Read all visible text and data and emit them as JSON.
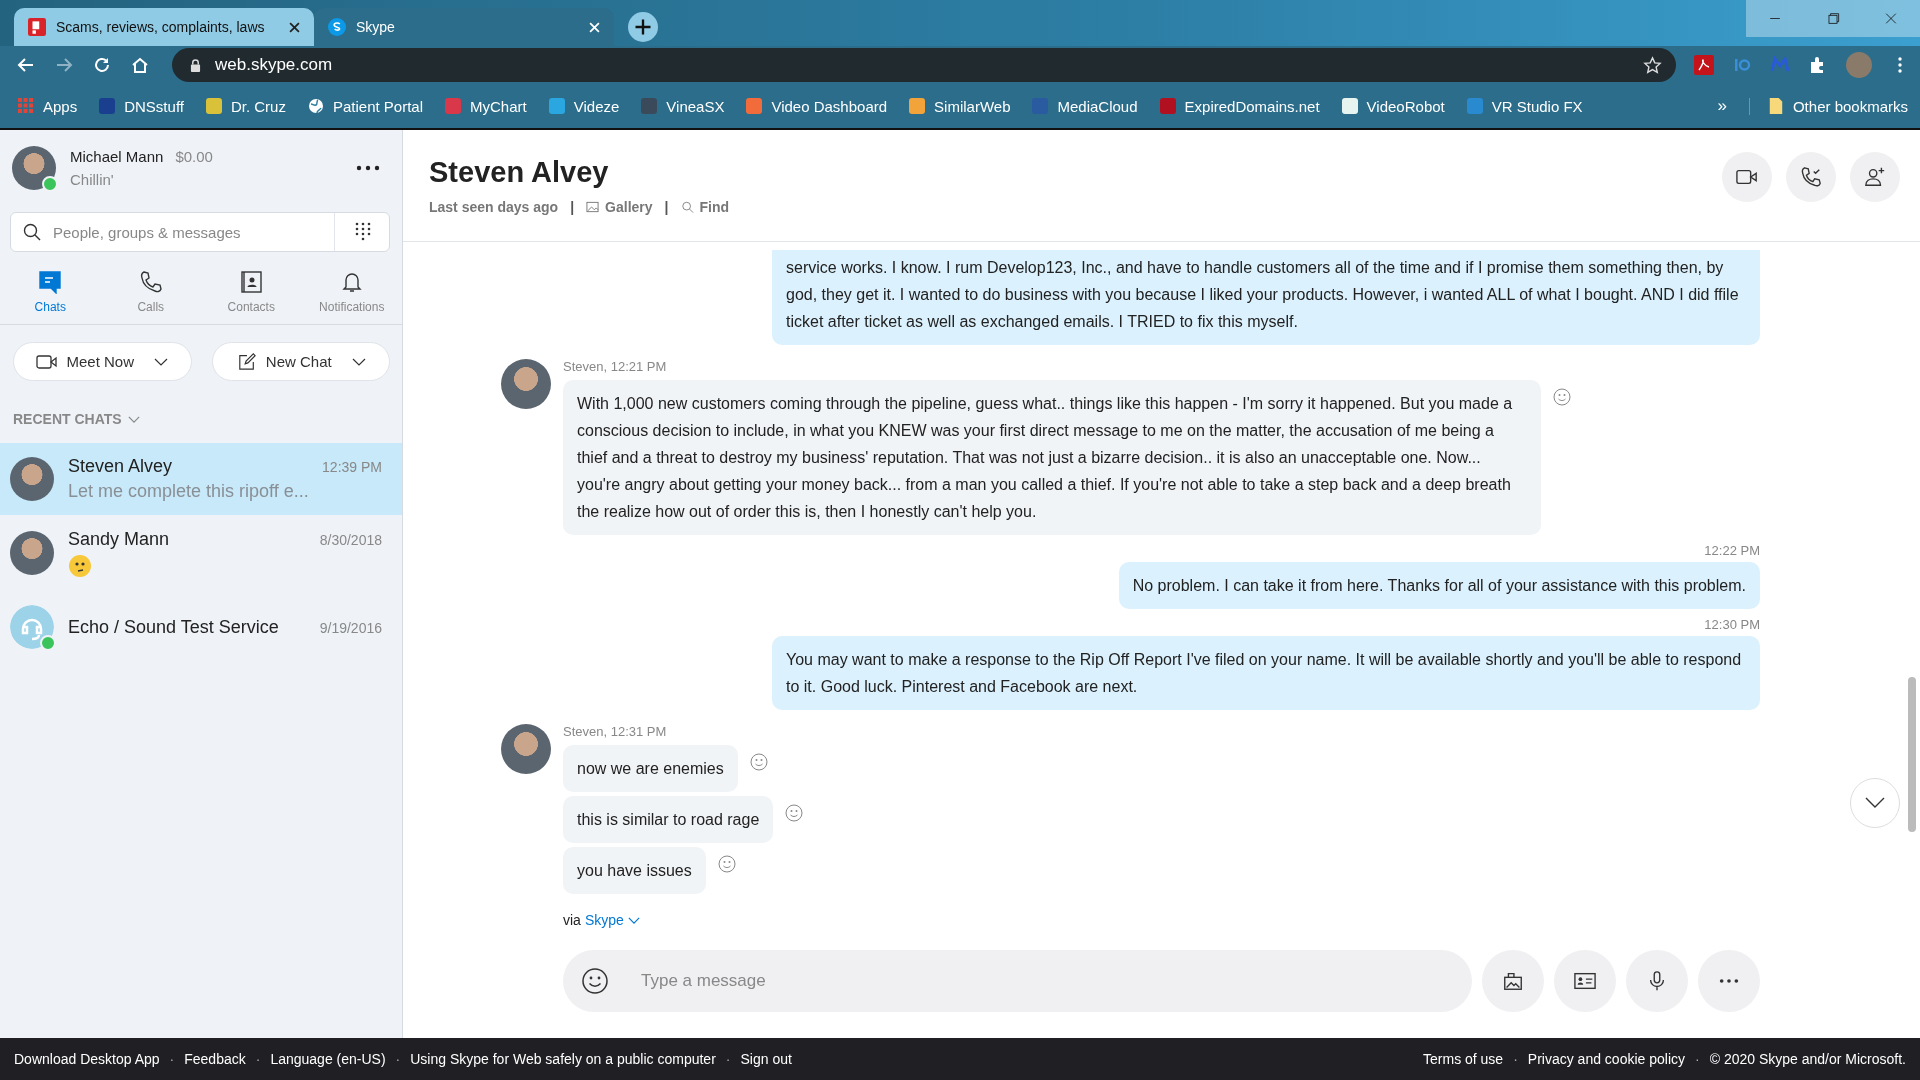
{
  "browser": {
    "tabs": [
      {
        "title": "Scams, reviews, complaints, laws",
        "selected": false,
        "kind": "report"
      },
      {
        "title": "Skype",
        "selected": true,
        "kind": "skype"
      }
    ],
    "address": "web.skype.com",
    "bookmarks": [
      {
        "label": "Apps",
        "kind": "apps",
        "color": "#e0453a"
      },
      {
        "label": "DNSstuff",
        "kind": "site",
        "color": "#1a3f8f"
      },
      {
        "label": "Dr. Cruz",
        "kind": "site",
        "color": "#d9c23a"
      },
      {
        "label": "Patient Portal",
        "kind": "globe",
        "color": "#ffffff"
      },
      {
        "label": "MyChart",
        "kind": "site",
        "color": "#d8384a"
      },
      {
        "label": "Videze",
        "kind": "site",
        "color": "#2aa6e0"
      },
      {
        "label": "VineaSX",
        "kind": "site",
        "color": "#3a4a5a"
      },
      {
        "label": "Video Dashboard",
        "kind": "site",
        "color": "#f26b3a"
      },
      {
        "label": "SimilarWeb",
        "kind": "site",
        "color": "#f2a33a"
      },
      {
        "label": "MediaCloud",
        "kind": "site",
        "color": "#2a5aa0"
      },
      {
        "label": "ExpiredDomains.net",
        "kind": "site",
        "color": "#b01020"
      },
      {
        "label": "VideoRobot",
        "kind": "site",
        "color": "#e8f4f0"
      },
      {
        "label": "VR Studio FX",
        "kind": "site",
        "color": "#2a8ad0"
      }
    ],
    "overflow": "»",
    "other_bookmarks": "Other bookmarks"
  },
  "profile": {
    "name": "Michael Mann",
    "credit": "$0.00",
    "mood": "Chillin'",
    "online": true
  },
  "search": {
    "placeholder": "People, groups & messages"
  },
  "nav": [
    {
      "label": "Chats",
      "kind": "chats",
      "selected": true
    },
    {
      "label": "Calls",
      "kind": "calls",
      "selected": false
    },
    {
      "label": "Contacts",
      "kind": "contacts",
      "selected": false
    },
    {
      "label": "Notifications",
      "kind": "notifications",
      "selected": false
    }
  ],
  "actions": {
    "meet_now": "Meet Now",
    "new_chat": "New Chat"
  },
  "recent_heading": "RECENT CHATS",
  "chats": [
    {
      "kind": "person",
      "name": "Steven Alvey",
      "time": "12:39 PM",
      "preview": "Let me complete this ripoff e...",
      "online": false,
      "selected": true
    },
    {
      "kind": "person",
      "name": "Sandy Mann",
      "time": "8/30/2018",
      "emoji": true,
      "online": false,
      "selected": false
    },
    {
      "kind": "bot",
      "name": "Echo / Sound Test Service",
      "time": "9/19/2016",
      "online": true,
      "selected": false
    }
  ],
  "conversation": {
    "name": "Steven Alvey",
    "last_seen": "Last seen days ago",
    "separator": "|",
    "gallery": "Gallery",
    "find": "Find"
  },
  "messages": [
    {
      "kind": "sent",
      "text": "service works. I know. I rum Develop123, Inc., and have to handle customers all of the time and if I promise them something then, by god, they get it. I wanted to do business with you because I liked your products. However, i wanted ALL of what I bought. AND I did ffile ticket after ticket as well as exchanged emails. I TRIED to fix this myself."
    },
    {
      "kind": "received",
      "header": "Steven, 12:21 PM",
      "bubbles": [
        "With 1,000 new customers coming through the pipeline, guess what.. things like this happen - I'm sorry it happened.  But you made a conscious decision to include, in what you KNEW was your first direct message to me on the matter, the accusation of me being a thief and a threat to destroy my business' reputation.  That was not just a bizarre decision.. it is also an unacceptable one.   Now... you're angry about getting your money back... from a man you called a thief.  If you're not able to take a step back and a deep breath the realize how out of order this is, then I honestly can't help you."
      ]
    },
    {
      "kind": "sent",
      "time": "12:22 PM",
      "text": "No problem. I can take it from here. Thanks for all of your assistance with this problem."
    },
    {
      "kind": "sent",
      "time": "12:30 PM",
      "text": "You may want to make a response to the Rip Off Report I've filed on your name. It will be available shortly and you'll be able to respond to it. Good luck. Pinterest and Facebook are next."
    },
    {
      "kind": "received",
      "header": "Steven, 12:31 PM",
      "bubbles": [
        "now we are enemies",
        "this is similar to road rage",
        "you have issues"
      ]
    }
  ],
  "via": {
    "prefix": "via",
    "link": "Skype"
  },
  "compose": {
    "placeholder": "Type a message"
  },
  "footer": {
    "separator": "·",
    "left": [
      "Download Desktop App",
      "Feedback",
      "Language (en-US)",
      "Using Skype for Web safely on a public computer",
      "Sign out"
    ],
    "right": [
      "Terms of use",
      "Privacy and cookie policy",
      "© 2020 Skype and/or Microsoft."
    ]
  }
}
